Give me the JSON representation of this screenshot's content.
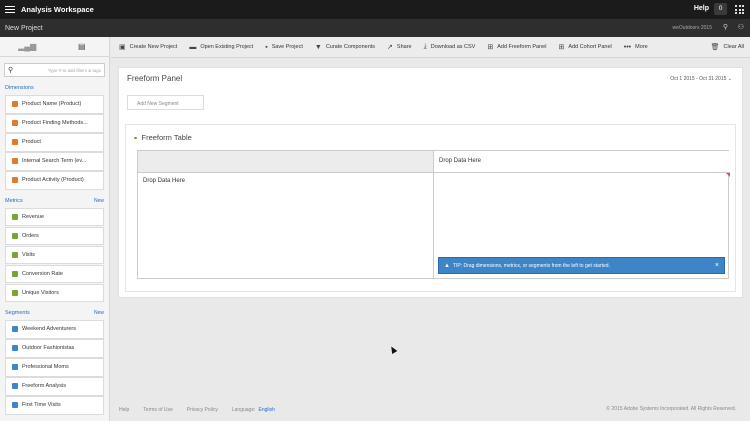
{
  "app": {
    "title": "Analysis Workspace",
    "help_label": "Help",
    "notification_count": "0"
  },
  "project": {
    "name": "New Project",
    "report_suite": "weOutdoors 2015"
  },
  "sidebar": {
    "search_placeholder": "Type # to add filters & tags",
    "dimensions": {
      "label": "Dimensions",
      "items": [
        {
          "label": "Product Name (Product)",
          "color": "#e07b2e"
        },
        {
          "label": "Product Finding Methods...",
          "color": "#e07b2e"
        },
        {
          "label": "Product",
          "color": "#e07b2e"
        },
        {
          "label": "Internal Search Term (ev...",
          "color": "#e07b2e"
        },
        {
          "label": "Product Activity (Product)",
          "color": "#e07b2e"
        }
      ]
    },
    "metrics": {
      "label": "Metrics",
      "new_label": "New",
      "items": [
        {
          "label": "Revenue",
          "color": "#7aa33b"
        },
        {
          "label": "Orders",
          "color": "#7aa33b"
        },
        {
          "label": "Visits",
          "color": "#7aa33b"
        },
        {
          "label": "Conversion Rate",
          "color": "#7aa33b"
        },
        {
          "label": "Unique Visitors",
          "color": "#7aa33b"
        }
      ]
    },
    "segments": {
      "label": "Segments",
      "new_label": "New",
      "items": [
        {
          "label": "Weekend Adventurers",
          "color": "#3d85c6"
        },
        {
          "label": "Outdoor Fashionistas",
          "color": "#3d85c6"
        },
        {
          "label": "Professional Moms",
          "color": "#3d85c6"
        },
        {
          "label": "Freeform Analysis",
          "color": "#3d85c6"
        },
        {
          "label": "First Time Visits",
          "color": "#3d85c6"
        }
      ]
    }
  },
  "toolbar": {
    "items": [
      {
        "label": "Create New Project",
        "icon": "new-project-icon"
      },
      {
        "label": "Open Existing Project",
        "icon": "folder-icon"
      },
      {
        "label": "Save Project",
        "icon": "save-icon"
      },
      {
        "label": "Curate Components",
        "icon": "filter-icon"
      },
      {
        "label": "Share",
        "icon": "share-icon"
      },
      {
        "label": "Download as CSV",
        "icon": "download-icon"
      },
      {
        "label": "Add Freeform Panel",
        "icon": "add-panel-icon"
      },
      {
        "label": "Add Cohort Panel",
        "icon": "add-panel-icon"
      },
      {
        "label": "More",
        "icon": "more-icon"
      }
    ],
    "clear_all": "Clear All"
  },
  "panel": {
    "title": "Freeform Panel",
    "date_range": "Oct 1 2015 - Oct 31 2015",
    "add_segment_placeholder": "Add New Segment",
    "table": {
      "title": "Freeform Table",
      "drop_column": "Drop Data Here",
      "drop_row": "Drop Data Here",
      "tip": "TIP: Drag dimensions, metrics, or segments from the left to get started."
    }
  },
  "footer": {
    "help": "Help",
    "terms": "Terms of Use",
    "privacy": "Privacy Policy",
    "language_label": "Language:",
    "language_value": "English",
    "copyright": "© 2015 Adobe Systems Incorporated. All Rights Reserved."
  }
}
